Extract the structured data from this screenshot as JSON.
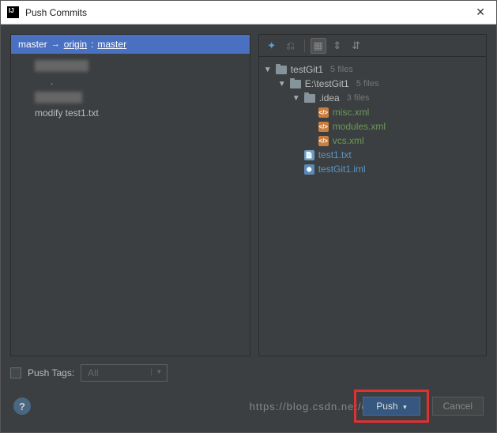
{
  "window": {
    "title": "Push Commits"
  },
  "branch": {
    "local": "master",
    "remote": "origin",
    "remoteBranch": "master"
  },
  "commits": {
    "blurred1": "████████",
    "blurred2": "███████",
    "visible": "modify test1.txt"
  },
  "tree": {
    "root": {
      "label": "testGit1",
      "count": "5 files"
    },
    "sub1": {
      "label": "E:\\testGit1",
      "count": "5 files"
    },
    "sub2": {
      "label": ".idea",
      "count": "3 files"
    },
    "files": {
      "misc": "misc.xml",
      "modules": "modules.xml",
      "vcs": "vcs.xml",
      "test1": "test1.txt",
      "iml": "testGit1.iml"
    }
  },
  "pushTags": {
    "label": "Push Tags:",
    "value": "All"
  },
  "buttons": {
    "push": "Push",
    "cancel": "Cancel"
  },
  "watermark": "https://blog.csdn.net/qq_"
}
